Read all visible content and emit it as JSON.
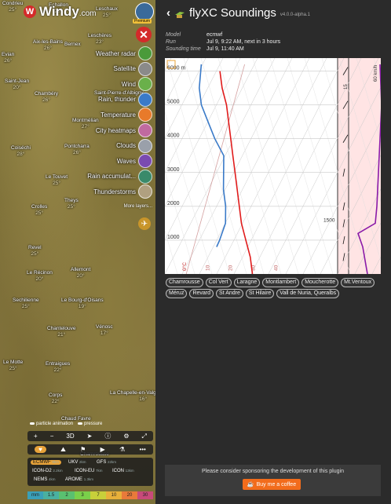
{
  "map": {
    "brand": "Windy",
    "brand_suffix": ".com",
    "premium_label": "Premium",
    "cities": [
      {
        "name": "Condrieu",
        "temp": "25°"
      },
      {
        "name": "Echallon",
        "temp": "23°"
      },
      {
        "name": "Leschaux",
        "temp": "25°"
      },
      {
        "name": "Aix-les-Bains",
        "temp": "26°"
      },
      {
        "name": "Bernex",
        "temp": ""
      },
      {
        "name": "Leschères",
        "temp": "23°"
      },
      {
        "name": "Evian",
        "temp": "26°"
      },
      {
        "name": "Chambéry",
        "temp": "26°"
      },
      {
        "name": "Saint-Pierre-d'Albigny",
        "temp": "27°"
      },
      {
        "name": "Montmélian",
        "temp": "27°"
      },
      {
        "name": "Coiséchi",
        "temp": "28°"
      },
      {
        "name": "Pontcharra",
        "temp": "26°"
      },
      {
        "name": "Le Touvet",
        "temp": "25°"
      },
      {
        "name": "Theys",
        "temp": "25°"
      },
      {
        "name": "Crolles",
        "temp": "25°"
      },
      {
        "name": "Revel",
        "temp": "25°"
      },
      {
        "name": "Allemont",
        "temp": "20°"
      },
      {
        "name": "Le Récinon",
        "temp": "20°"
      },
      {
        "name": "Sechilienne",
        "temp": "25°"
      },
      {
        "name": "Le Bourg-d'Oisans",
        "temp": "19°"
      },
      {
        "name": "Chantelouve",
        "temp": "21°"
      },
      {
        "name": "Vénosc",
        "temp": "17°"
      },
      {
        "name": "Entraigues",
        "temp": "22°"
      },
      {
        "name": "Corps",
        "temp": "22°"
      },
      {
        "name": "La Chapelle-en-Valgaudémar",
        "temp": "16°"
      },
      {
        "name": "Chaud Favre",
        "temp": ""
      },
      {
        "name": "Le Motte",
        "temp": "25°"
      },
      {
        "name": "Saint-Jean",
        "temp": "20°"
      },
      {
        "name": "Chamrousse",
        "temp": ""
      }
    ],
    "layers": [
      {
        "label": "Weather radar",
        "color": "#4a9a3a"
      },
      {
        "label": "Satellite",
        "color": "#8a8a8a"
      },
      {
        "label": "Wind",
        "color": "#6ab04a"
      },
      {
        "label": "Rain, thunder",
        "color": "#3a7ac8"
      },
      {
        "label": "Temperature",
        "color": "#e87a2a"
      },
      {
        "label": "City heatmaps",
        "color": "#c06aa0"
      },
      {
        "label": "Clouds",
        "color": "#9aa0aa"
      },
      {
        "label": "Waves",
        "color": "#7a4ab0"
      },
      {
        "label": "Rain accumulat...",
        "color": "#3a8a6a"
      },
      {
        "label": "Thunderstorms",
        "color": "#b0a080"
      }
    ],
    "more_layers": "More layers...",
    "toggles": [
      "particle animation",
      "pressure"
    ],
    "controls": [
      "+",
      "−",
      "3D",
      "➤",
      "ⓘ",
      "⚙",
      "⤢"
    ],
    "icon_row": [
      "♥",
      "⛰",
      "⚑",
      "▶",
      "⚗",
      "•••"
    ],
    "models": [
      {
        "name": "ECMWF",
        "res": "9km",
        "selected": true
      },
      {
        "name": "UKV",
        "res": "2km",
        "selected": false
      },
      {
        "name": "GFS",
        "res": "22km",
        "selected": false
      },
      {
        "name": "ICON-D2",
        "res": "2.2km",
        "selected": false
      },
      {
        "name": "ICON-EU",
        "res": "7km",
        "selected": false
      },
      {
        "name": "ICON",
        "res": "13km",
        "selected": false
      },
      {
        "name": "NEMS",
        "res": "4km",
        "selected": false
      },
      {
        "name": "AROME",
        "res": "1.3km",
        "selected": false
      }
    ],
    "scale": [
      {
        "label": "mm",
        "color": "#3aa0b8"
      },
      {
        "label": "1.5",
        "color": "#4ab0a0"
      },
      {
        "label": "2",
        "color": "#5ac070"
      },
      {
        "label": "3",
        "color": "#7ad04a"
      },
      {
        "label": "7",
        "color": "#c8d03a"
      },
      {
        "label": "10",
        "color": "#e8b03a"
      },
      {
        "label": "20",
        "color": "#e87a3a"
      },
      {
        "label": "30",
        "color": "#c84a7a"
      }
    ]
  },
  "panel": {
    "title": "flyXC Soundings",
    "version": "v4.0.0-alpha.1",
    "info": [
      {
        "key": "Model",
        "value": "ecmwf"
      },
      {
        "key": "Run",
        "value": "Jul 9, 9:22 AM, next in 3 hours"
      },
      {
        "key": "Sounding time",
        "value": "Jul 9, 11:40 AM"
      }
    ],
    "sites": [
      "Chamrousse",
      "Col Vert",
      "Laragne",
      "Montlambert",
      "Moucherotte",
      "Mt.Ventoux",
      "Méruz",
      "Revard",
      "St Andre",
      "St Hilaire",
      "Vall de Nuria, Queralbs"
    ],
    "sponsor_text": "Please consider sponsoring the development of this plugin",
    "coffee_label": "Buy me a coffee"
  },
  "chart_data": {
    "type": "line",
    "title": "",
    "ylabel": "",
    "y_unit": "m",
    "y_ticks": [
      1000,
      2000,
      3000,
      4000,
      5000,
      6000
    ],
    "x_ticks": [
      -20,
      -10,
      0,
      10,
      20,
      30,
      40
    ],
    "x_tick_labels": [
      "-20",
      "-10",
      "0°C",
      "10",
      "20",
      "30",
      "40"
    ],
    "zero_label": "0°C",
    "ylim": [
      0,
      6200
    ],
    "xlim": [
      -30,
      45
    ],
    "series": [
      {
        "color": "#e01b1b",
        "values": [
          [
            29,
            0
          ],
          [
            26,
            500
          ],
          [
            22,
            1000
          ],
          [
            18,
            1500
          ],
          [
            15,
            2000
          ],
          [
            12,
            2500
          ],
          [
            9,
            3000
          ],
          [
            6,
            3500
          ],
          [
            3,
            4000
          ],
          [
            0,
            4500
          ],
          [
            -3,
            5000
          ],
          [
            -7,
            5500
          ],
          [
            -10,
            6000
          ]
        ]
      },
      {
        "color": "#3a7ac8",
        "values": [
          [
            10,
            800
          ],
          [
            10.5,
            1000
          ],
          [
            11,
            1500
          ],
          [
            9,
            2000
          ],
          [
            6,
            2500
          ],
          [
            4,
            3000
          ],
          [
            2,
            3500
          ],
          [
            -4,
            4000
          ],
          [
            -9,
            4500
          ],
          [
            -14,
            5000
          ],
          [
            -17,
            5500
          ],
          [
            -19,
            6200
          ]
        ]
      }
    ],
    "cloud_base_label": "1500",
    "wind_panel": {
      "label": "60 km/h",
      "speed_mark": "15"
    }
  }
}
